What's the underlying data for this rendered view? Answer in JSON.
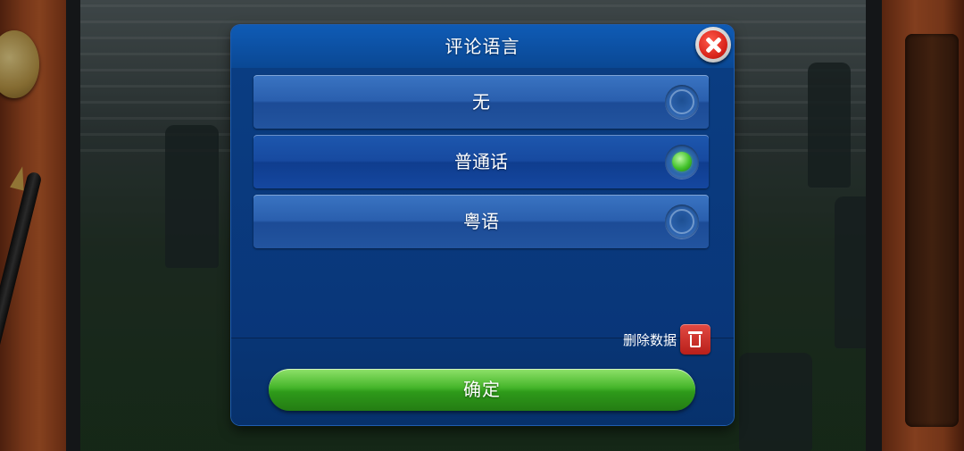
{
  "dialog": {
    "title": "评论语言",
    "options": [
      {
        "label": "无",
        "selected": false
      },
      {
        "label": "普通话",
        "selected": true
      },
      {
        "label": "粤语",
        "selected": false
      }
    ],
    "delete_data_label": "删除数据",
    "confirm_label": "确定"
  },
  "icons": {
    "close": "close-icon",
    "radio_selected": "radio-selected-icon",
    "radio_unselected": "radio-unselected-icon",
    "trash": "trash-icon"
  },
  "colors": {
    "dialog_blue": "#0a3c82",
    "confirm_green": "#45b52a",
    "close_red": "#d8231a",
    "selected_dot_green": "#44c32c"
  }
}
